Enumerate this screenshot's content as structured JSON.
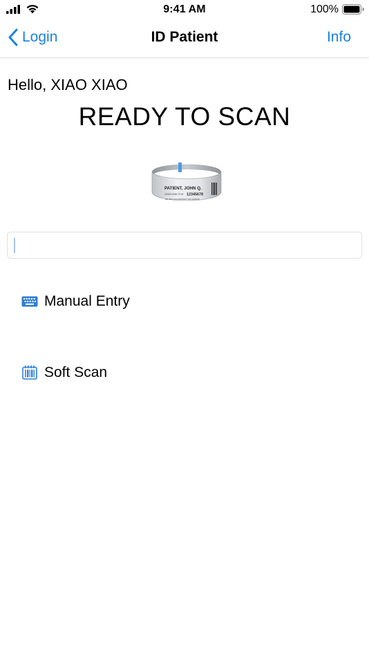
{
  "status_bar": {
    "time": "9:41 AM",
    "battery_percent": "100%",
    "battery_level": 1.0,
    "icons": [
      "signal-icon",
      "wifi-icon",
      "battery-icon"
    ]
  },
  "nav": {
    "back_label": "Login",
    "title": "ID Patient",
    "info_label": "Info"
  },
  "main": {
    "greeting": "Hello, XIAO XIAO",
    "heading": "READY TO SCAN",
    "wristband": {
      "name": "PATIENT, JOHN Q.",
      "line2": "12/02/1938  72  M",
      "id": "12345678",
      "line3": "DR WILLIAM PRICKET  12/2 10/2019"
    },
    "scan_input": {
      "value": "",
      "placeholder": ""
    },
    "actions": [
      {
        "label": "Manual Entry",
        "icon": "keyboard-icon"
      },
      {
        "label": "Soft Scan",
        "icon": "barcode-scan-icon"
      }
    ]
  },
  "colors": {
    "accent": "#1a82e2",
    "icon_blue": "#2f7fd1",
    "divider": "#d8d8dc"
  }
}
